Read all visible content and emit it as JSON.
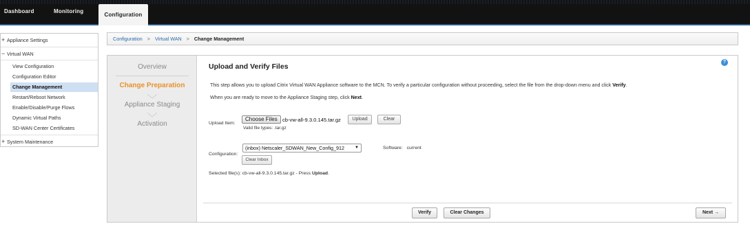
{
  "topnav": {
    "tabs": [
      "Dashboard",
      "Monitoring",
      "Configuration"
    ]
  },
  "sidebar": {
    "appliance_settings": "Appliance Settings",
    "virtual_wan": "Virtual WAN",
    "items": [
      "View Configuration",
      "Configuration Editor",
      "Change Management",
      "Restart/Reboot Network",
      "Enable/Disable/Purge Flows",
      "Dynamic Virtual Paths",
      "SD-WAN Center Certificates"
    ],
    "system_maintenance": "System Maintenance",
    "plus_symbol": "+",
    "minus_symbol": "−"
  },
  "breadcrumb": {
    "items": [
      "Configuration",
      "Virtual WAN",
      "Change Management"
    ],
    "separator": ">"
  },
  "steps": [
    "Overview",
    "Change Preparation",
    "Appliance Staging",
    "Activation"
  ],
  "main": {
    "title": "Upload and Verify Files",
    "help_icon_text": "?",
    "para1_start": "This step allows you to upload Citrix Virtual WAN Appliance software to the MCN. To verify a particular configuration without proceeding, select the file from the drop-down menu and click ",
    "para1_bold": "Verify",
    "para1_end": ".",
    "para2_start": "When you are ready to move to the Appliance Staging step, click ",
    "para2_bold": "Next",
    "para2_end": ".",
    "upload_label": "Upload Item:",
    "choose_files": "Choose Files",
    "chosen_file": "cb-vw-all-9.3.0.145.tar.gz",
    "upload_button": "Upload",
    "clear_button": "Clear",
    "valid_types": "Valid file types: .tar.gz",
    "config_label": "Configuration:",
    "config_selected": "(inbox) Netscaler_SDWAN_New_Config_912",
    "clear_inbox": "Clear Inbox",
    "software_label": "Software:",
    "software_value": "current",
    "selected_files_start": "Selected file(s): cb-vw-all-9.3.0.145.tar.gz - Press ",
    "selected_files_bold": "Upload",
    "selected_files_end": ".",
    "verify_button": "Verify",
    "clear_changes_button": "Clear Changes",
    "next_button": "Next →"
  },
  "colors": {
    "accent_orange": "#e8912a",
    "link_blue": "#2b6aa8",
    "selected_bg": "#cfe0f3",
    "topbar_bg": "#121212"
  }
}
